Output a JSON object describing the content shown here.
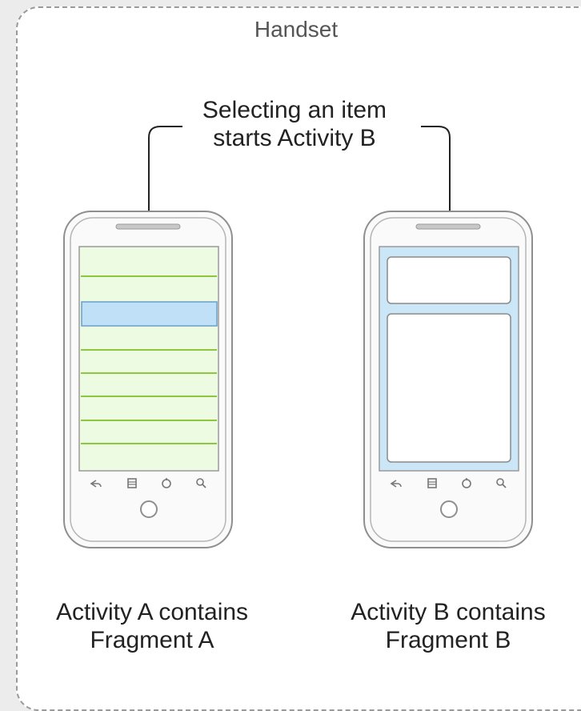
{
  "diagram": {
    "container_label": "Handset",
    "callout": {
      "line1": "Selecting an item",
      "line2": "starts Activity B"
    },
    "phone_a": {
      "caption_line1": "Activity A contains",
      "caption_line2": "Fragment A",
      "list_rows": 7,
      "selected_row_index": 1,
      "list_background": "#eefbe3",
      "row_divider_color": "#8dc63f",
      "selected_row_color": "#bfe0f6"
    },
    "phone_b": {
      "caption_line1": "Activity B contains",
      "caption_line2": "Fragment B",
      "screen_background": "#cbe6f7"
    },
    "colors": {
      "frame_border": "#9a9a9a",
      "arrow": "#222222",
      "phone_outline": "#8f8f8f"
    },
    "nav_icons": [
      "back-icon",
      "menu-icon",
      "home-icon",
      "search-icon"
    ]
  }
}
